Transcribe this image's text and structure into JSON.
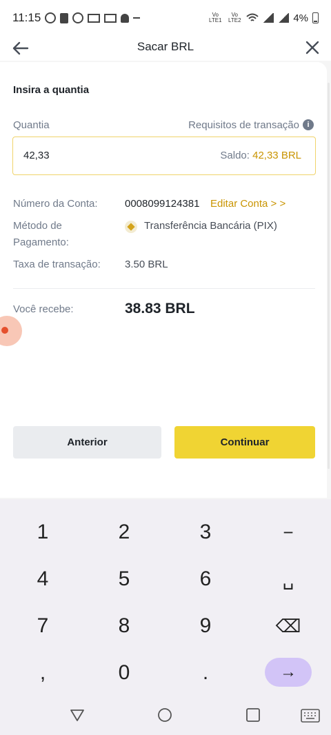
{
  "status_bar": {
    "time": "11:15",
    "network_1": "Vo LTE1",
    "network_2": "Vo LTE2",
    "battery": "4%"
  },
  "header": {
    "title": "Sacar BRL",
    "back_icon": "arrow-left-icon",
    "close_icon": "close-icon"
  },
  "form": {
    "section_title": "Insira a quantia",
    "amount_label": "Quantia",
    "requirements_label": "Requisitos de transação",
    "amount_value": "42,33",
    "balance_label": "Saldo:",
    "balance_value": "42,33 BRL",
    "account_number_label": "Número da Conta:",
    "account_number": "0008099124381",
    "edit_account": "Editar Conta > >",
    "payment_method_label_1": "Método de",
    "payment_method_label_2": "Pagamento:",
    "payment_method": "Transferência Bancária (PIX)",
    "fee_label": "Taxa de transação:",
    "fee_value": "3.50 BRL",
    "receive_label": "Você recebe:",
    "receive_value": "38.83 BRL"
  },
  "buttons": {
    "previous": "Anterior",
    "continue": "Continuar"
  },
  "keyboard": {
    "keys": [
      "1",
      "2",
      "3",
      "−",
      "4",
      "5",
      "6",
      "␣",
      "7",
      "8",
      "9",
      "⌫",
      ",",
      "0",
      ".",
      "→"
    ]
  },
  "colors": {
    "accent": "#F0D433",
    "link": "#C99400",
    "enter_key": "#D2C4F7"
  }
}
